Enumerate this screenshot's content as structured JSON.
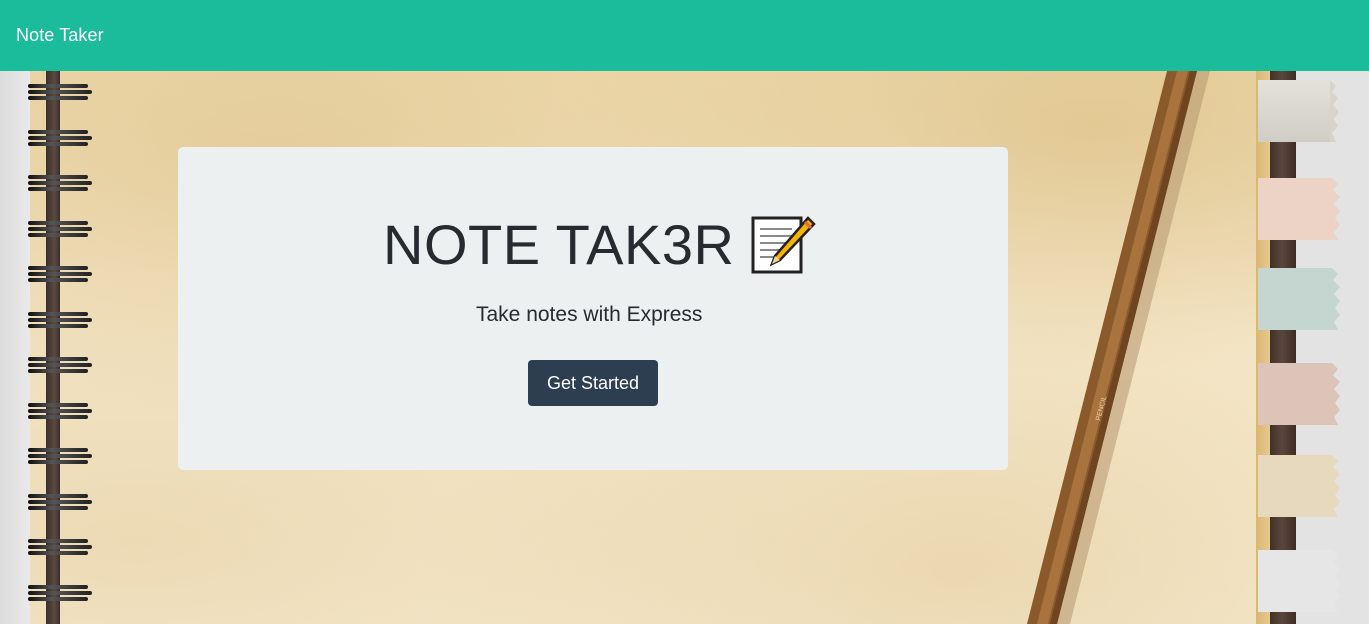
{
  "navbar": {
    "brand": "Note Taker",
    "color": "#1abc9c"
  },
  "hero": {
    "title": "NOTE TAK3R",
    "title_icon": "memo-icon",
    "subtitle": "Take notes with Express",
    "button_label": "Get Started",
    "button_color": "#2c3e50"
  },
  "background": {
    "pencil_label": "PENCIL"
  }
}
